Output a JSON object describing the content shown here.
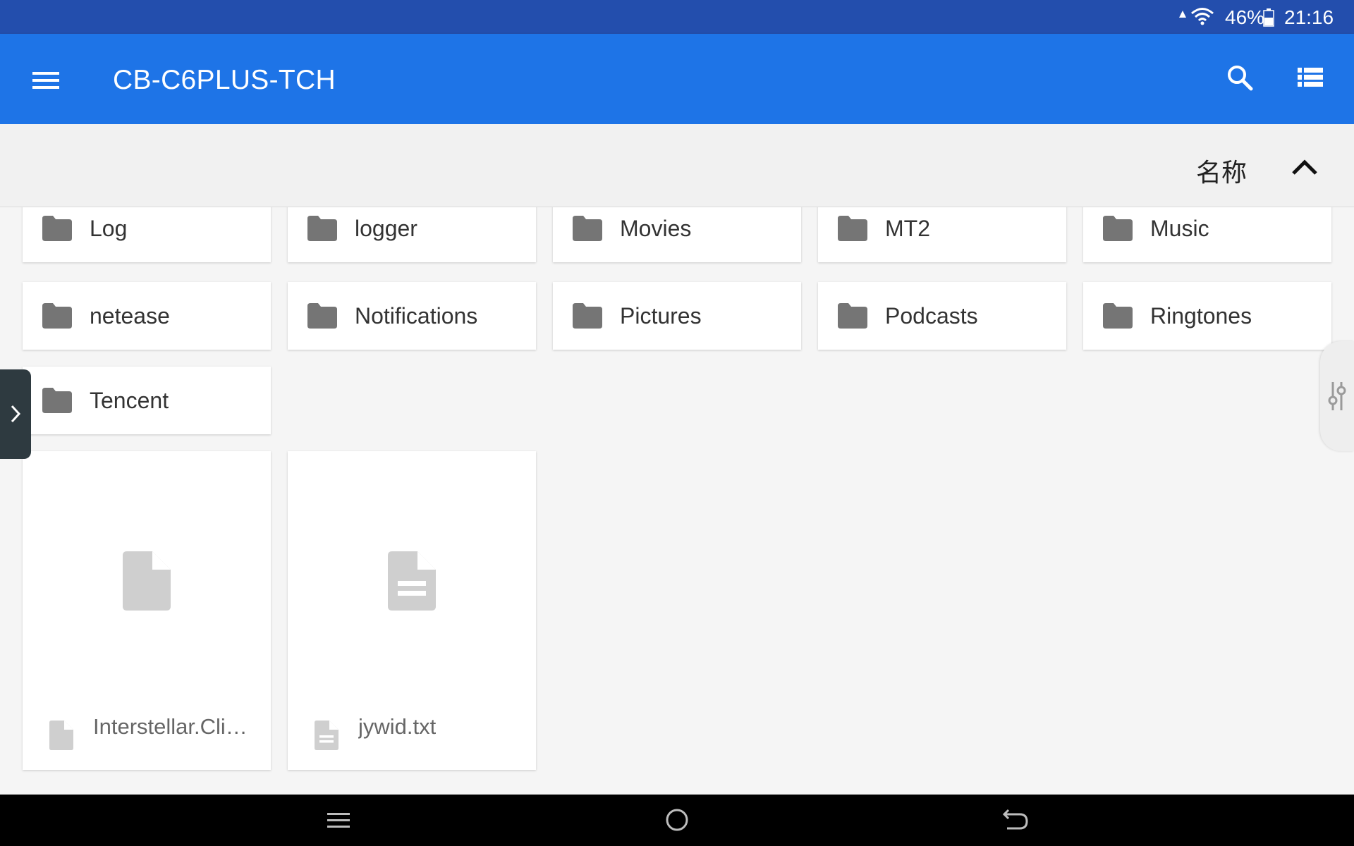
{
  "status_bar": {
    "battery": "46%",
    "time": "21:16",
    "icons": [
      "signal-icon",
      "wifi-icon",
      "battery-icon"
    ]
  },
  "app_bar": {
    "title": "CB-C6PLUS-TCH",
    "icons": [
      "menu-icon",
      "search-icon",
      "list-view-icon"
    ],
    "color": "#1e74e7"
  },
  "sort_bar": {
    "label": "名称",
    "direction_icon": "chevron-up-icon"
  },
  "folders": [
    {
      "name": "Log"
    },
    {
      "name": "logger"
    },
    {
      "name": "Movies"
    },
    {
      "name": "MT2"
    },
    {
      "name": "Music"
    },
    {
      "name": "netease"
    },
    {
      "name": "Notifications"
    },
    {
      "name": "Pictures"
    },
    {
      "name": "Podcasts"
    },
    {
      "name": "Ringtones"
    },
    {
      "name": "Tencent"
    }
  ],
  "files": [
    {
      "name": "Interstellar.Cli…",
      "icon": "file-icon"
    },
    {
      "name": "jywid.txt",
      "icon": "text-file-icon"
    }
  ],
  "nav_bar": {
    "icons": [
      "recents-icon",
      "home-icon",
      "back-icon"
    ]
  },
  "colors": {
    "status_bar": "#234ead",
    "app_bar": "#1e74e7",
    "folder_icon": "#757575",
    "file_icon": "#cfcfcf"
  }
}
